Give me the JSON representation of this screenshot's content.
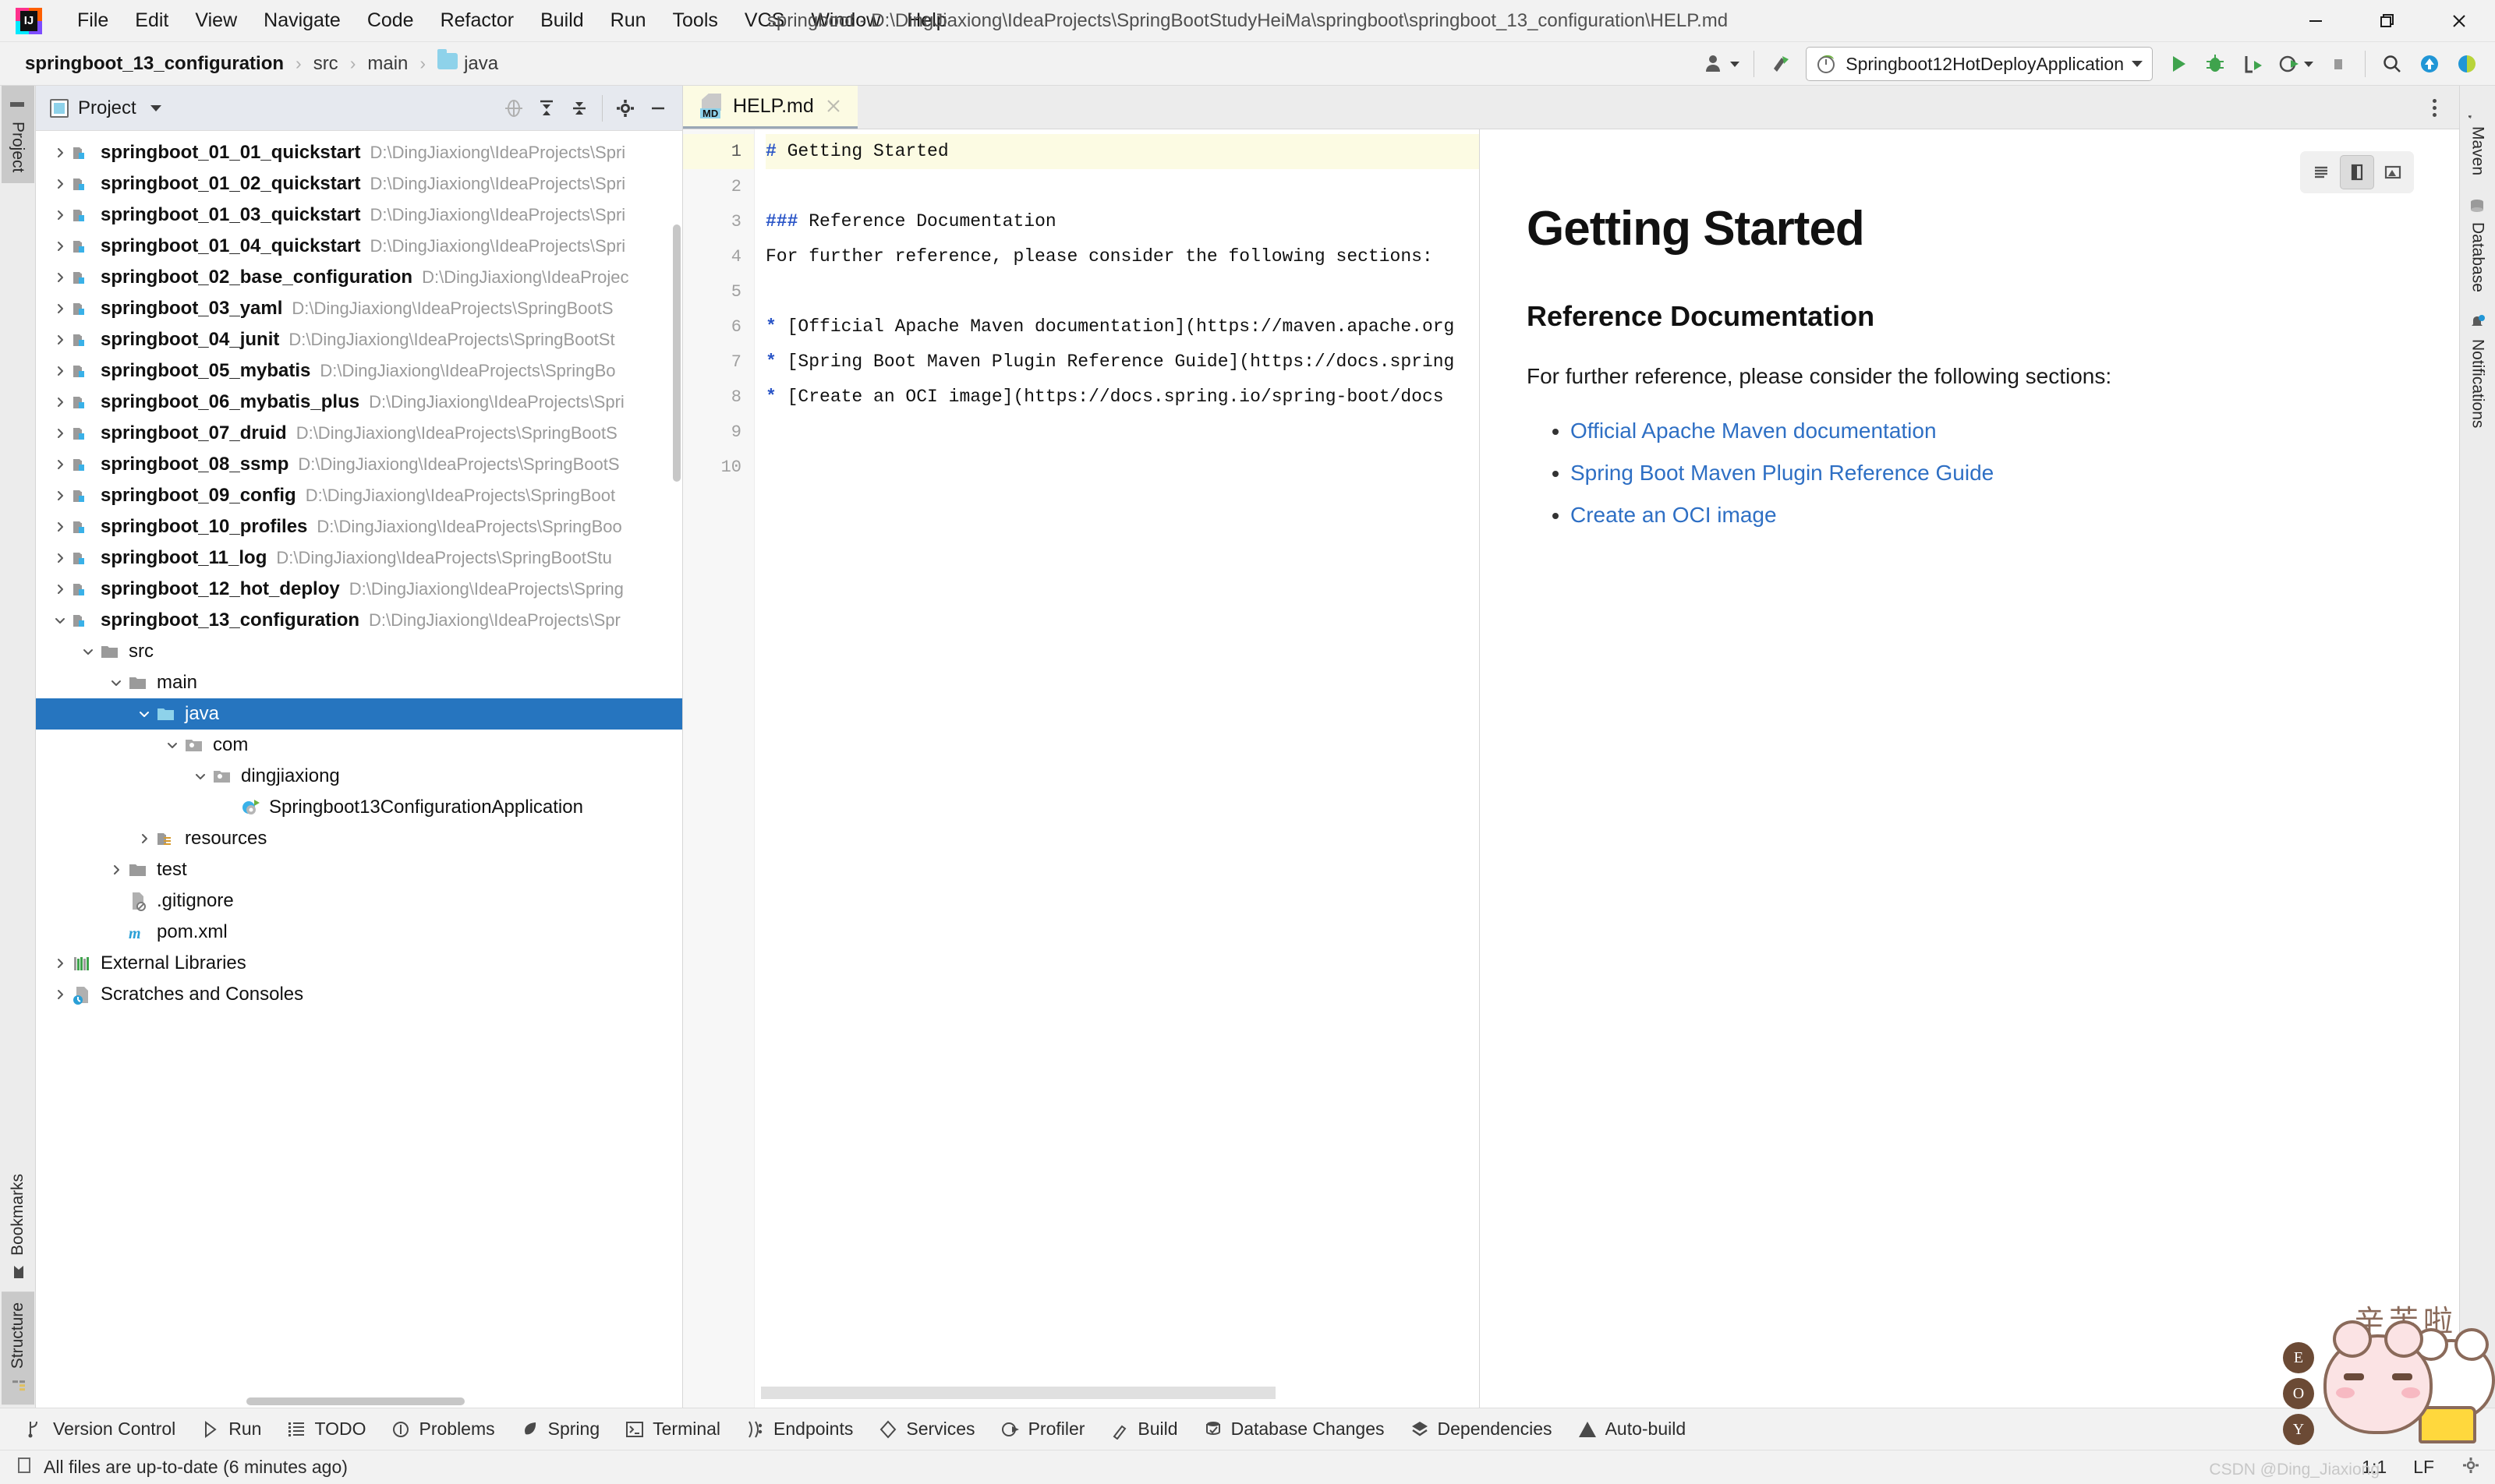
{
  "window": {
    "title": "springboot - D:\\DingJiaxiong\\IdeaProjects\\SpringBootStudyHeiMa\\springboot\\springboot_13_configuration\\HELP.md",
    "minimize_label": "Minimize",
    "restore_label": "Restore",
    "close_label": "Close"
  },
  "menubar": [
    {
      "label": "File"
    },
    {
      "label": "Edit"
    },
    {
      "label": "View"
    },
    {
      "label": "Navigate"
    },
    {
      "label": "Code"
    },
    {
      "label": "Refactor"
    },
    {
      "label": "Build"
    },
    {
      "label": "Run"
    },
    {
      "label": "Tools"
    },
    {
      "label": "VCS"
    },
    {
      "label": "Window"
    },
    {
      "label": "Help"
    }
  ],
  "breadcrumbs": [
    {
      "label": "springboot_13_configuration",
      "bold": true,
      "folder": false
    },
    {
      "label": "src",
      "bold": false,
      "folder": false
    },
    {
      "label": "main",
      "bold": false,
      "folder": false
    },
    {
      "label": "java",
      "bold": false,
      "folder": true
    }
  ],
  "toolbar": {
    "run_config": "Springboot12HotDeployApplication",
    "run_label": "Run",
    "debug_label": "Debug",
    "run_coverage_label": "Run with Coverage",
    "profile_label": "Profile",
    "stop_label": "Stop",
    "search_label": "Search Everywhere",
    "updates_label": "Updates",
    "settings_sync_label": "Settings Sync",
    "user_label": "Account",
    "build_label": "Build Project"
  },
  "left_strip": [
    {
      "label": "Project",
      "active": true
    },
    {
      "label": "Bookmarks",
      "active": false
    },
    {
      "label": "Structure",
      "active": false
    }
  ],
  "right_strip": [
    {
      "label": "Maven",
      "icon": "maven-icon"
    },
    {
      "label": "Database",
      "icon": "database-icon"
    },
    {
      "label": "Notifications",
      "icon": "bell-icon",
      "badge": true
    }
  ],
  "project_panel": {
    "title": "Project",
    "select_opened_file_label": "Select Opened File",
    "expand_all_label": "Expand All",
    "collapse_all_label": "Collapse All",
    "settings_label": "Options",
    "hide_label": "Hide"
  },
  "tree": [
    {
      "label": "springboot_01_01_quickstart",
      "path": "D:\\DingJiaxiong\\IdeaProjects\\Spri",
      "depth": 0,
      "icon": "module-icon",
      "state": "collapsed",
      "bold": true,
      "selected": false
    },
    {
      "label": "springboot_01_02_quickstart",
      "path": "D:\\DingJiaxiong\\IdeaProjects\\Spri",
      "depth": 0,
      "icon": "module-icon",
      "state": "collapsed",
      "bold": true,
      "selected": false
    },
    {
      "label": "springboot_01_03_quickstart",
      "path": "D:\\DingJiaxiong\\IdeaProjects\\Spri",
      "depth": 0,
      "icon": "module-icon",
      "state": "collapsed",
      "bold": true,
      "selected": false
    },
    {
      "label": "springboot_01_04_quickstart",
      "path": "D:\\DingJiaxiong\\IdeaProjects\\Spri",
      "depth": 0,
      "icon": "module-icon",
      "state": "collapsed",
      "bold": true,
      "selected": false
    },
    {
      "label": "springboot_02_base_configuration",
      "path": "D:\\DingJiaxiong\\IdeaProjec",
      "depth": 0,
      "icon": "module-icon",
      "state": "collapsed",
      "bold": true,
      "selected": false
    },
    {
      "label": "springboot_03_yaml",
      "path": "D:\\DingJiaxiong\\IdeaProjects\\SpringBootS",
      "depth": 0,
      "icon": "module-icon",
      "state": "collapsed",
      "bold": true,
      "selected": false
    },
    {
      "label": "springboot_04_junit",
      "path": "D:\\DingJiaxiong\\IdeaProjects\\SpringBootSt",
      "depth": 0,
      "icon": "module-icon",
      "state": "collapsed",
      "bold": true,
      "selected": false
    },
    {
      "label": "springboot_05_mybatis",
      "path": "D:\\DingJiaxiong\\IdeaProjects\\SpringBo",
      "depth": 0,
      "icon": "module-icon",
      "state": "collapsed",
      "bold": true,
      "selected": false
    },
    {
      "label": "springboot_06_mybatis_plus",
      "path": "D:\\DingJiaxiong\\IdeaProjects\\Spri",
      "depth": 0,
      "icon": "module-icon",
      "state": "collapsed",
      "bold": true,
      "selected": false
    },
    {
      "label": "springboot_07_druid",
      "path": "D:\\DingJiaxiong\\IdeaProjects\\SpringBootS",
      "depth": 0,
      "icon": "module-icon",
      "state": "collapsed",
      "bold": true,
      "selected": false
    },
    {
      "label": "springboot_08_ssmp",
      "path": "D:\\DingJiaxiong\\IdeaProjects\\SpringBootS",
      "depth": 0,
      "icon": "module-icon",
      "state": "collapsed",
      "bold": true,
      "selected": false
    },
    {
      "label": "springboot_09_config",
      "path": "D:\\DingJiaxiong\\IdeaProjects\\SpringBoot",
      "depth": 0,
      "icon": "module-icon",
      "state": "collapsed",
      "bold": true,
      "selected": false
    },
    {
      "label": "springboot_10_profiles",
      "path": "D:\\DingJiaxiong\\IdeaProjects\\SpringBoo",
      "depth": 0,
      "icon": "module-icon",
      "state": "collapsed",
      "bold": true,
      "selected": false
    },
    {
      "label": "springboot_11_log",
      "path": "D:\\DingJiaxiong\\IdeaProjects\\SpringBootStu",
      "depth": 0,
      "icon": "module-icon",
      "state": "collapsed",
      "bold": true,
      "selected": false
    },
    {
      "label": "springboot_12_hot_deploy",
      "path": "D:\\DingJiaxiong\\IdeaProjects\\Spring",
      "depth": 0,
      "icon": "module-icon",
      "state": "collapsed",
      "bold": true,
      "selected": false
    },
    {
      "label": "springboot_13_configuration",
      "path": "D:\\DingJiaxiong\\IdeaProjects\\Spr",
      "depth": 0,
      "icon": "module-icon",
      "state": "expanded",
      "bold": true,
      "selected": false
    },
    {
      "label": "src",
      "path": "",
      "depth": 1,
      "icon": "folder-icon",
      "state": "expanded",
      "bold": false,
      "selected": false
    },
    {
      "label": "main",
      "path": "",
      "depth": 2,
      "icon": "folder-icon",
      "state": "expanded",
      "bold": false,
      "selected": false
    },
    {
      "label": "java",
      "path": "",
      "depth": 3,
      "icon": "source-folder-icon",
      "state": "expanded",
      "bold": false,
      "selected": true
    },
    {
      "label": "com",
      "path": "",
      "depth": 4,
      "icon": "package-icon",
      "state": "expanded",
      "bold": false,
      "selected": false
    },
    {
      "label": "dingjiaxiong",
      "path": "",
      "depth": 5,
      "icon": "package-icon",
      "state": "expanded",
      "bold": false,
      "selected": false
    },
    {
      "label": "Springboot13ConfigurationApplication",
      "path": "",
      "depth": 6,
      "icon": "spring-class-icon",
      "state": "leaf",
      "bold": false,
      "selected": false
    },
    {
      "label": "resources",
      "path": "",
      "depth": 3,
      "icon": "resources-folder-icon",
      "state": "collapsed",
      "bold": false,
      "selected": false
    },
    {
      "label": "test",
      "path": "",
      "depth": 2,
      "icon": "folder-icon",
      "state": "collapsed",
      "bold": false,
      "selected": false
    },
    {
      "label": ".gitignore",
      "path": "",
      "depth": 2,
      "icon": "gitignore-icon",
      "state": "leaf",
      "bold": false,
      "selected": false
    },
    {
      "label": "pom.xml",
      "path": "",
      "depth": 2,
      "icon": "maven-pom-icon",
      "state": "leaf",
      "bold": false,
      "selected": false
    },
    {
      "label": "External Libraries",
      "path": "",
      "depth": 0,
      "icon": "libraries-icon",
      "state": "collapsed",
      "bold": false,
      "selected": false
    },
    {
      "label": "Scratches and Consoles",
      "path": "",
      "depth": 0,
      "icon": "scratches-icon",
      "state": "collapsed",
      "bold": false,
      "selected": false
    }
  ],
  "editor": {
    "tab": {
      "name": "HELP.md",
      "icon": "markdown-icon",
      "close_label": "Close"
    },
    "options_label": "Editor Options",
    "line_numbers": [
      "1",
      "2",
      "3",
      "4",
      "5",
      "6",
      "7",
      "8",
      "9",
      "10"
    ],
    "current_line": 1,
    "lines": [
      {
        "n": 1,
        "prefix": "# ",
        "text": "Getting Started"
      },
      {
        "n": 2,
        "prefix": "",
        "text": ""
      },
      {
        "n": 3,
        "prefix": "### ",
        "text": "Reference Documentation"
      },
      {
        "n": 4,
        "prefix": "",
        "text": "For further reference, please consider the following sections:"
      },
      {
        "n": 5,
        "prefix": "",
        "text": ""
      },
      {
        "n": 6,
        "prefix": "* ",
        "text": "[Official Apache Maven documentation](https://maven.apache.org"
      },
      {
        "n": 7,
        "prefix": "* ",
        "text": "[Spring Boot Maven Plugin Reference Guide](https://docs.spring"
      },
      {
        "n": 8,
        "prefix": "* ",
        "text": "[Create an OCI image](https://docs.spring.io/spring-boot/docs"
      },
      {
        "n": 9,
        "prefix": "",
        "text": ""
      },
      {
        "n": 10,
        "prefix": "",
        "text": ""
      }
    ]
  },
  "preview": {
    "view_modes": [
      {
        "name": "editor-only",
        "label": "Show editor only",
        "active": false
      },
      {
        "name": "editor-and-preview",
        "label": "Show editor and preview",
        "active": true
      },
      {
        "name": "preview-only",
        "label": "Show preview only",
        "active": false
      }
    ],
    "h1": "Getting Started",
    "h3": "Reference Documentation",
    "paragraph": "For further reference, please consider the following sections:",
    "links": [
      "Official Apache Maven documentation",
      "Spring Boot Maven Plugin Reference Guide",
      "Create an OCI image"
    ]
  },
  "toolwindow_bar": [
    {
      "label": "Version Control",
      "icon": "branch-icon"
    },
    {
      "label": "Run",
      "icon": "play-icon"
    },
    {
      "label": "TODO",
      "icon": "todo-icon"
    },
    {
      "label": "Problems",
      "icon": "problems-icon"
    },
    {
      "label": "Spring",
      "icon": "spring-leaf-icon"
    },
    {
      "label": "Terminal",
      "icon": "terminal-icon"
    },
    {
      "label": "Endpoints",
      "icon": "endpoints-icon"
    },
    {
      "label": "Services",
      "icon": "services-icon"
    },
    {
      "label": "Profiler",
      "icon": "profiler-icon"
    },
    {
      "label": "Build",
      "icon": "hammer-icon"
    },
    {
      "label": "Database Changes",
      "icon": "db-changes-icon"
    },
    {
      "label": "Dependencies",
      "icon": "dependencies-icon"
    },
    {
      "label": "Auto-build",
      "icon": "warning-icon"
    }
  ],
  "statusbar": {
    "message": "All files are up-to-date (6 minutes ago)",
    "caret": "1:1",
    "line_separator": "LF",
    "watermark": "CSDN @Ding_Jiaxiong"
  },
  "sticker": {
    "text": "辛苦啦",
    "medals": [
      "E",
      "O",
      "Y"
    ]
  },
  "colors": {
    "accent_blue": "#2675bf",
    "link_blue": "#2e6fc4",
    "md_syntax": "#2a55c7",
    "folder_blue": "#8ed2ea",
    "tab_bg": "#fcfbe3"
  }
}
